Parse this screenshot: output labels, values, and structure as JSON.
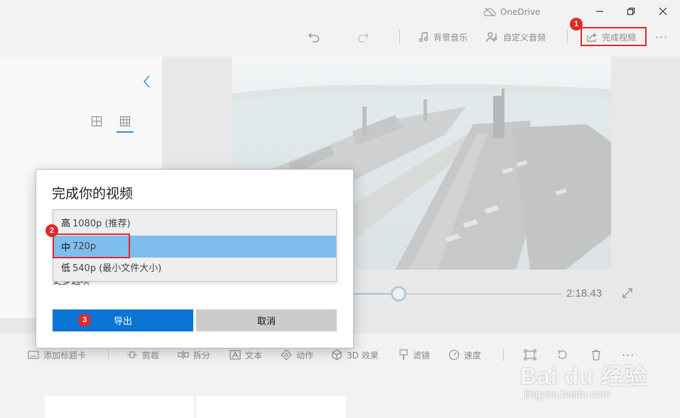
{
  "titlebar": {
    "onedrive_label": "OneDrive",
    "icons": [
      "cloud-off-icon",
      "minimize-icon",
      "restore-icon",
      "close-icon"
    ]
  },
  "toolbar": {
    "background_music": "背景音乐",
    "custom_audio": "自定义音频",
    "finish_video": "完成视频",
    "more": "···"
  },
  "video": {
    "duration": "2:18.43",
    "progress_fraction": 0.22
  },
  "bottom_toolbar": {
    "add_title_card": "添加标题卡",
    "trim": "剪裁",
    "split": "拆分",
    "text": "文本",
    "motion": "动作",
    "effects_3d": "3D 效果",
    "filters": "滤镜",
    "speed": "速度",
    "more": "···"
  },
  "dialog": {
    "title": "完成你的视频",
    "options": [
      {
        "lead": "高",
        "rest": "1080p (推荐)"
      },
      {
        "lead": "中",
        "rest": "720p"
      },
      {
        "lead": "低",
        "rest": "540p (最小文件大小)"
      }
    ],
    "selected_index": 1,
    "more_options": "更多选项",
    "export_label": "导出",
    "cancel_label": "取消"
  },
  "annotations": {
    "step1": "1",
    "step2": "2",
    "step3": "3"
  },
  "watermark": {
    "main": "Bai du 经验",
    "sub": "jingyan.baidu.com"
  },
  "colors": {
    "accent": "#0a75d4",
    "selected_option": "#7fbdec",
    "annotation_red": "#e02828"
  }
}
